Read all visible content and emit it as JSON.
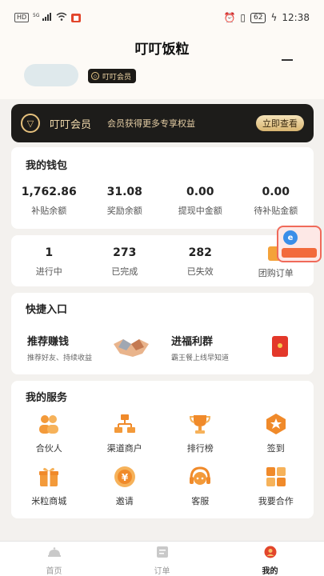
{
  "status": {
    "left_chips": [
      "HD",
      "5G"
    ],
    "battery": "62",
    "time": "12:38"
  },
  "header": {
    "title": "叮叮饭粒"
  },
  "profile": {
    "member_badge": "叮叮会员"
  },
  "vip": {
    "title": "叮叮会员",
    "desc": "会员获得更多专享权益",
    "button": "立即查看"
  },
  "wallet": {
    "title": "我的钱包",
    "stats": [
      {
        "value": "1,762.86",
        "label": "补贴余额"
      },
      {
        "value": "31.08",
        "label": "奖励余额"
      },
      {
        "value": "0.00",
        "label": "提现中金额"
      },
      {
        "value": "0.00",
        "label": "待补贴金额"
      }
    ]
  },
  "orders": {
    "stats": [
      {
        "value": "1",
        "label": "进行中"
      },
      {
        "value": "273",
        "label": "已完成"
      },
      {
        "value": "282",
        "label": "已失效"
      },
      {
        "value": "",
        "label": "团购订单"
      }
    ]
  },
  "quick": {
    "title": "快捷入口",
    "items": [
      {
        "title": "推荐赚钱",
        "sub": "推荐好友、持续收益"
      },
      {
        "title": "进福利群",
        "sub": "霸王餐上线早知道"
      }
    ]
  },
  "services": {
    "title": "我的服务",
    "items": [
      {
        "label": "合伙人",
        "icon": "partner-icon"
      },
      {
        "label": "渠道商户",
        "icon": "channel-merchant-icon"
      },
      {
        "label": "排行榜",
        "icon": "trophy-icon"
      },
      {
        "label": "签到",
        "icon": "checkin-icon"
      },
      {
        "label": "米粒商城",
        "icon": "gift-icon"
      },
      {
        "label": "邀请",
        "icon": "invite-icon"
      },
      {
        "label": "客服",
        "icon": "headset-icon"
      },
      {
        "label": "我要合作",
        "icon": "cooperate-icon"
      }
    ]
  },
  "tabbar": {
    "items": [
      {
        "label": "首页"
      },
      {
        "label": "订单"
      },
      {
        "label": "我的"
      }
    ]
  },
  "colors": {
    "accent": "#f08a2a",
    "gold": "#e6c17d",
    "vip_bg": "#1d1c1a"
  }
}
